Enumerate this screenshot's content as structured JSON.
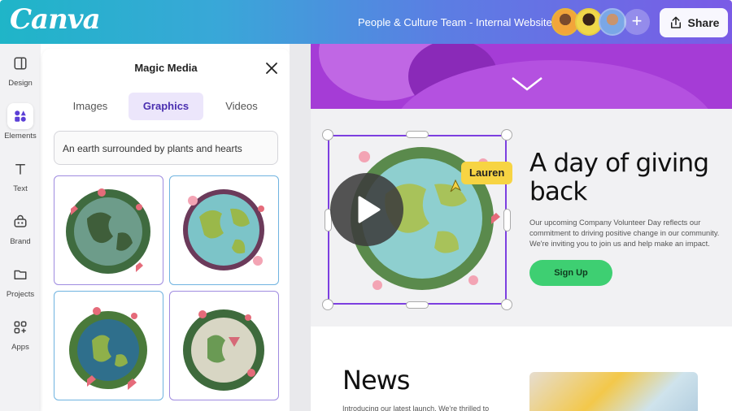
{
  "app": {
    "logo": "Canva",
    "document_title": "People & Culture Team - Internal Website"
  },
  "header": {
    "share_label": "Share",
    "add_label": "+"
  },
  "rail": {
    "items": [
      {
        "label": "Design",
        "icon": "design-icon"
      },
      {
        "label": "Elements",
        "icon": "elements-icon",
        "active": true
      },
      {
        "label": "Text",
        "icon": "text-icon"
      },
      {
        "label": "Brand",
        "icon": "brand-icon"
      },
      {
        "label": "Projects",
        "icon": "projects-icon"
      },
      {
        "label": "Apps",
        "icon": "apps-icon"
      }
    ]
  },
  "panel": {
    "title": "Magic Media",
    "tabs": [
      "Images",
      "Graphics",
      "Videos"
    ],
    "active_tab": "Graphics",
    "search_value": "An earth surrounded by plants and hearts",
    "results_count": 4
  },
  "canvas": {
    "heading": "A day of giving back",
    "body": "Our upcoming Company Volunteer Day reflects our commitment to driving positive change in our community. We're inviting you to join us and help make an impact.",
    "cta": "Sign Up",
    "collaborator_tag": "Lauren",
    "news_title": "News",
    "news_text": "Introducing our latest launch. We're thrilled to"
  },
  "colors": {
    "accent": "#7c3fe0",
    "cta": "#3ecf72",
    "hero": "#9b2fd0",
    "tag": "#f7d443"
  }
}
